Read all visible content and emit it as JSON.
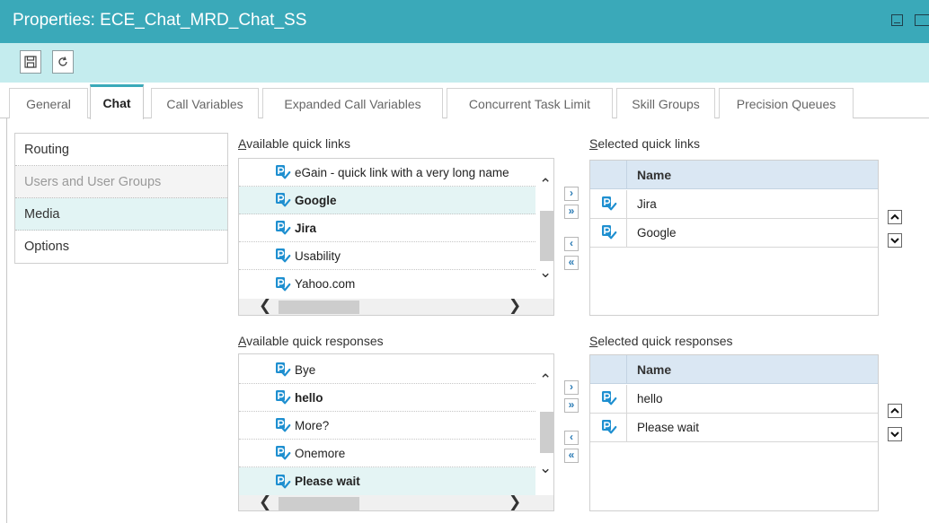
{
  "window": {
    "title": "Properties: ECE_Chat_MRD_Chat_SS"
  },
  "toolbar": {
    "save_icon": "save-icon",
    "refresh_icon": "refresh-icon"
  },
  "tabs": [
    {
      "label": "General"
    },
    {
      "label": "Chat"
    },
    {
      "label": "Call Variables"
    },
    {
      "label": "Expanded Call Variables"
    },
    {
      "label": "Concurrent Task Limit"
    },
    {
      "label": "Skill Groups"
    },
    {
      "label": "Precision Queues"
    }
  ],
  "active_tab": "Chat",
  "sidebar": {
    "items": [
      {
        "label": "Routing"
      },
      {
        "label": "Users and User Groups"
      },
      {
        "label": "Media"
      },
      {
        "label": "Options"
      }
    ]
  },
  "quick_links": {
    "available_label": "Available quick links",
    "available_underline": "A",
    "available_rest": "vailable quick links",
    "available": [
      {
        "label": "eGain - quick link with a very long name"
      },
      {
        "label": "Google"
      },
      {
        "label": "Jira"
      },
      {
        "label": "Usability"
      },
      {
        "label": "Yahoo.com"
      }
    ],
    "selected_label": "Selected quick links",
    "selected_underline": "S",
    "selected_rest": "elected quick links",
    "column_header": "Name",
    "selected": [
      {
        "label": "Jira"
      },
      {
        "label": "Google"
      }
    ]
  },
  "quick_responses": {
    "available_label": "Available quick responses",
    "available_underline": "A",
    "available_rest": "vailable quick responses",
    "available": [
      {
        "label": "Bye"
      },
      {
        "label": "hello"
      },
      {
        "label": "More?"
      },
      {
        "label": "Onemore"
      },
      {
        "label": "Please wait"
      }
    ],
    "selected_label": "Selected quick responses",
    "selected_underline": "S",
    "selected_rest": "elected quick responses",
    "column_header": "Name",
    "selected": [
      {
        "label": "hello"
      },
      {
        "label": "Please wait"
      }
    ]
  },
  "colors": {
    "titlebar": "#3aa9b9",
    "toolbar": "#c4ecee",
    "accent": "#3aa9b9",
    "icon_blue": "#1e8fd0"
  }
}
